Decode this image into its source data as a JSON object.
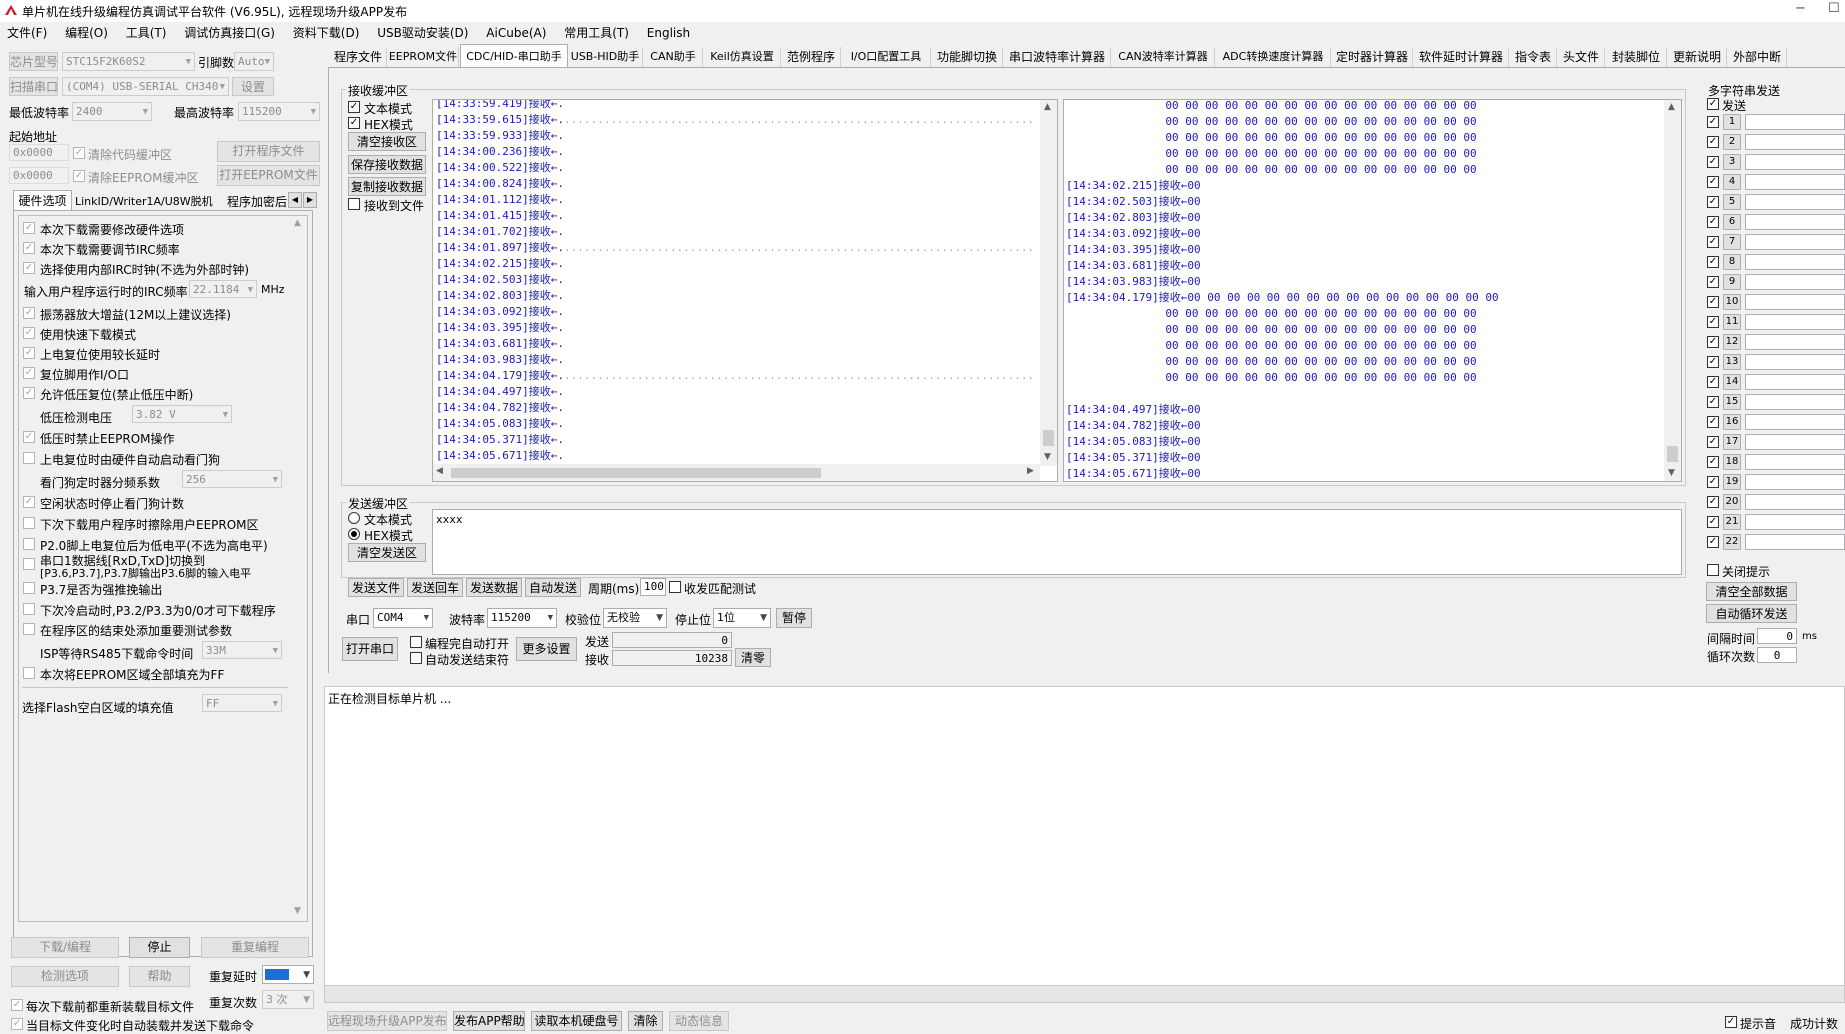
{
  "window": {
    "title": "单片机在线升级编程仿真调试平台软件 (V6.95L), 远程现场升级APP发布",
    "controls": [
      "−",
      "☐"
    ]
  },
  "menu": [
    "文件(F)",
    "编程(O)",
    "工具(T)",
    "调试仿真接口(G)",
    "资料下载(D)",
    "USB驱动安装(D)",
    "AiCube(A)",
    "常用工具(T)",
    "English"
  ],
  "left": {
    "chip_btn": "芯片型号",
    "chip_value": "STC15F2K60S2",
    "pins_label": "引脚数",
    "pins_value": "Auto",
    "scan_btn": "扫描串口",
    "port_value": "(COM4) USB-SERIAL CH340",
    "settings_btn": "设置",
    "min_baud_label": "最低波特率",
    "min_baud_value": "2400",
    "max_baud_label": "最高波特率",
    "max_baud_value": "115200",
    "start_addr_label": "起始地址",
    "addr1": "0x0000",
    "clear_code": "清除代码缓冲区",
    "open_prog": "打开程序文件",
    "addr2": "0x0000",
    "clear_eeprom": "清除EEPROM缓冲区",
    "open_eeprom": "打开EEPROM文件",
    "tabs": [
      "硬件选项",
      "LinkID/Writer1A/U8W脱机",
      "程序加密后"
    ],
    "tab_arrows": [
      "◀",
      "▶"
    ],
    "hw_options": [
      {
        "label": "本次下载需要修改硬件选项",
        "checked": true
      },
      {
        "label": "本次下载需要调节IRC频率",
        "checked": true
      },
      {
        "label": "选择使用内部IRC时钟(不选为外部时钟)",
        "checked": true
      },
      {
        "label": "振荡器放大增益(12M以上建议选择)",
        "checked": true
      },
      {
        "label": "使用快速下载模式",
        "checked": true
      },
      {
        "label": "上电复位使用较长延时",
        "checked": true
      },
      {
        "label": "复位脚用作I/O口",
        "checked": true
      },
      {
        "label": "允许低压复位(禁止低压中断)",
        "checked": true
      },
      {
        "label": "低压时禁止EEPROM操作",
        "checked": true
      },
      {
        "label": "上电复位时由硬件自动启动看门狗",
        "checked": false
      },
      {
        "label": "空闲状态时停止看门狗计数",
        "checked": true
      },
      {
        "label": "下次下载用户程序时擦除用户EEPROM区",
        "checked": false
      },
      {
        "label": "P2.0脚上电复位后为低电平(不选为高电平)",
        "checked": false
      },
      {
        "label": "串口1数据线[RxD,TxD]切换到",
        "checked": false
      },
      {
        "label": "P3.7是否为强推挽输出",
        "checked": false
      },
      {
        "label": "下次冷启动时,P3.2/P3.3为0/0才可下载程序",
        "checked": false
      },
      {
        "label": "在程序区的结束处添加重要测试参数",
        "checked": false
      },
      {
        "label": "本次将EEPROM区域全部填充为FF",
        "checked": false
      }
    ],
    "uart_switch_line2": "[P3.6,P3.7],P3.7脚输出P3.6脚的输入电平",
    "irc_label": "输入用户程序运行时的IRC频率",
    "irc_value": "22.1184",
    "irc_unit": "MHz",
    "lvd_label": "低压检测电压",
    "lvd_value": "3.82 V",
    "wdt_label": "看门狗定时器分频系数",
    "wdt_value": "256",
    "isp_label": "ISP等待RS485下载命令时间",
    "isp_value": "33M",
    "flash_fill_label": "选择Flash空白区域的填充值",
    "flash_fill_value": "FF",
    "download_btn": "下载/编程",
    "stop_btn": "停止",
    "reprogram_btn": "重复编程",
    "check_btn": "检测选项",
    "help_btn": "帮助",
    "repeat_delay_label": "重复延时",
    "repeat_count_label": "重复次数",
    "repeat_count_value": "3 次",
    "reload_each": "每次下载前都重新装载目标文件",
    "auto_reload": "当目标文件变化时自动装载并发送下载命令"
  },
  "tabs": [
    "程序文件",
    "EEPROM文件",
    "CDC/HID-串口助手",
    "USB-HID助手",
    "CAN助手",
    "Keil仿真设置",
    "范例程序",
    "I/O口配置工具",
    "功能脚切换",
    "串口波特率计算器",
    "CAN波特率计算器",
    "ADC转换速度计算器",
    "定时器计算器",
    "软件延时计算器",
    "指令表",
    "头文件",
    "封装脚位",
    "更新说明",
    "外部中断"
  ],
  "active_tab": "CDC/HID-串口助手",
  "rx": {
    "title": "接收缓冲区",
    "text_mode": "文本模式",
    "hex_mode": "HEX模式",
    "clear_btn": "清空接收区",
    "save_btn": "保存接收数据",
    "copy_btn": "复制接收数据",
    "to_file": "接收到文件",
    "left_lines": [
      {
        "t": "[14:33:59.419]",
        "m": "接收←.",
        "dots": false
      },
      {
        "t": "[14:33:59.615]",
        "m": "接收←.",
        "dots": true
      },
      {
        "t": "[14:33:59.933]",
        "m": "接收←.",
        "dots": false
      },
      {
        "t": "[14:34:00.236]",
        "m": "接收←.",
        "dots": false
      },
      {
        "t": "[14:34:00.522]",
        "m": "接收←.",
        "dots": false
      },
      {
        "t": "[14:34:00.824]",
        "m": "接收←.",
        "dots": false
      },
      {
        "t": "[14:34:01.112]",
        "m": "接收←.",
        "dots": false
      },
      {
        "t": "[14:34:01.415]",
        "m": "接收←.",
        "dots": false
      },
      {
        "t": "[14:34:01.702]",
        "m": "接收←.",
        "dots": false
      },
      {
        "t": "[14:34:01.897]",
        "m": "接收←.",
        "dots": true
      },
      {
        "t": "[14:34:02.215]",
        "m": "接收←.",
        "dots": false
      },
      {
        "t": "[14:34:02.503]",
        "m": "接收←.",
        "dots": false
      },
      {
        "t": "[14:34:02.803]",
        "m": "接收←.",
        "dots": false
      },
      {
        "t": "[14:34:03.092]",
        "m": "接收←.",
        "dots": false
      },
      {
        "t": "[14:34:03.395]",
        "m": "接收←.",
        "dots": false
      },
      {
        "t": "[14:34:03.681]",
        "m": "接收←.",
        "dots": false
      },
      {
        "t": "[14:34:03.983]",
        "m": "接收←.",
        "dots": false
      },
      {
        "t": "[14:34:04.179]",
        "m": "接收←.",
        "dots": true
      },
      {
        "t": "[14:34:04.497]",
        "m": "接收←.",
        "dots": false
      },
      {
        "t": "[14:34:04.782]",
        "m": "接收←.",
        "dots": false
      },
      {
        "t": "[14:34:05.083]",
        "m": "接收←.",
        "dots": false
      },
      {
        "t": "[14:34:05.371]",
        "m": "接收←.",
        "dots": false
      },
      {
        "t": "[14:34:05.671]",
        "m": "接收←.",
        "dots": false
      }
    ],
    "dotfill": "....................................................................................",
    "right_lines": [
      "               00 00 00 00 00 00 00 00 00 00 00 00 00 00 00 00",
      "               00 00 00 00 00 00 00 00 00 00 00 00 00 00 00 00",
      "               00 00 00 00 00 00 00 00 00 00 00 00 00 00 00 00",
      "               00 00 00 00 00 00 00 00 00 00 00 00 00 00 00 00",
      "               00 00 00 00 00 00 00 00 00 00 00 00 00 00 00 00",
      "[14:34:02.215]接收←00",
      "[14:34:02.503]接收←00",
      "[14:34:02.803]接收←00",
      "[14:34:03.092]接收←00",
      "[14:34:03.395]接收←00",
      "[14:34:03.681]接收←00",
      "[14:34:03.983]接收←00",
      "[14:34:04.179]接收←00 00 00 00 00 00 00 00 00 00 00 00 00 00 00 00",
      "               00 00 00 00 00 00 00 00 00 00 00 00 00 00 00 00",
      "               00 00 00 00 00 00 00 00 00 00 00 00 00 00 00 00",
      "               00 00 00 00 00 00 00 00 00 00 00 00 00 00 00 00",
      "               00 00 00 00 00 00 00 00 00 00 00 00 00 00 00 00",
      "               00 00 00 00 00 00 00 00 00 00 00 00 00 00 00 00",
      "[14:34:04.497]接收←00",
      "[14:34:04.782]接收←00",
      "[14:34:05.083]接收←00",
      "[14:34:05.371]接收←00",
      "[14:34:05.671]接收←00"
    ]
  },
  "tx": {
    "title": "发送缓冲区",
    "text_mode": "文本模式",
    "hex_mode": "HEX模式",
    "clear_btn": "清空发送区",
    "content": "xxxx",
    "send_file": "发送文件",
    "send_cr": "发送回车",
    "send_data": "发送数据",
    "auto_send": "自动发送",
    "period_label": "周期(ms)",
    "period_value": "100",
    "match_label": "收发匹配测试"
  },
  "port": {
    "port_label": "串口",
    "port_value": "COM4",
    "baud_label": "波特率",
    "baud_value": "115200",
    "parity_label": "校验位",
    "parity_value": "无校验",
    "stop_label": "停止位",
    "stop_value": "1位",
    "pause_btn": "暂停",
    "open_btn": "打开串口",
    "auto_open": "编程完自动打开",
    "auto_end": "自动发送结束符",
    "more_btn": "更多设置",
    "send_label": "发送",
    "send_count": "0",
    "recv_label": "接收",
    "recv_count": "10238",
    "clear_btn": "清零"
  },
  "multi": {
    "title": "多字符串发送",
    "send_label": "发送",
    "rows": [
      "1",
      "2",
      "3",
      "4",
      "5",
      "6",
      "7",
      "8",
      "9",
      "10",
      "11",
      "12",
      "13",
      "14",
      "15",
      "16",
      "17",
      "18",
      "19",
      "20",
      "21",
      "22"
    ],
    "close_tip": "关闭提示",
    "clear_all": "清空全部数据",
    "auto_loop": "自动循环发送",
    "interval_label": "间隔时间",
    "interval_value": "0",
    "interval_unit": "ms",
    "loop_label": "循环次数",
    "loop_value": "0"
  },
  "status": {
    "message": "正在检测目标单片机 ..."
  },
  "bottom": {
    "remote_btn": "远程现场升级APP发布",
    "help_btn": "发布APP帮助",
    "disk_btn": "读取本机硬盘号",
    "clear_btn": "清除",
    "dynamic_btn": "动态信息",
    "sound_label": "提示音",
    "success_label": "成功计数"
  },
  "colors": {
    "rx_text": "#1a1ab8",
    "repeat_delay_fill": "#1d6fd6"
  }
}
